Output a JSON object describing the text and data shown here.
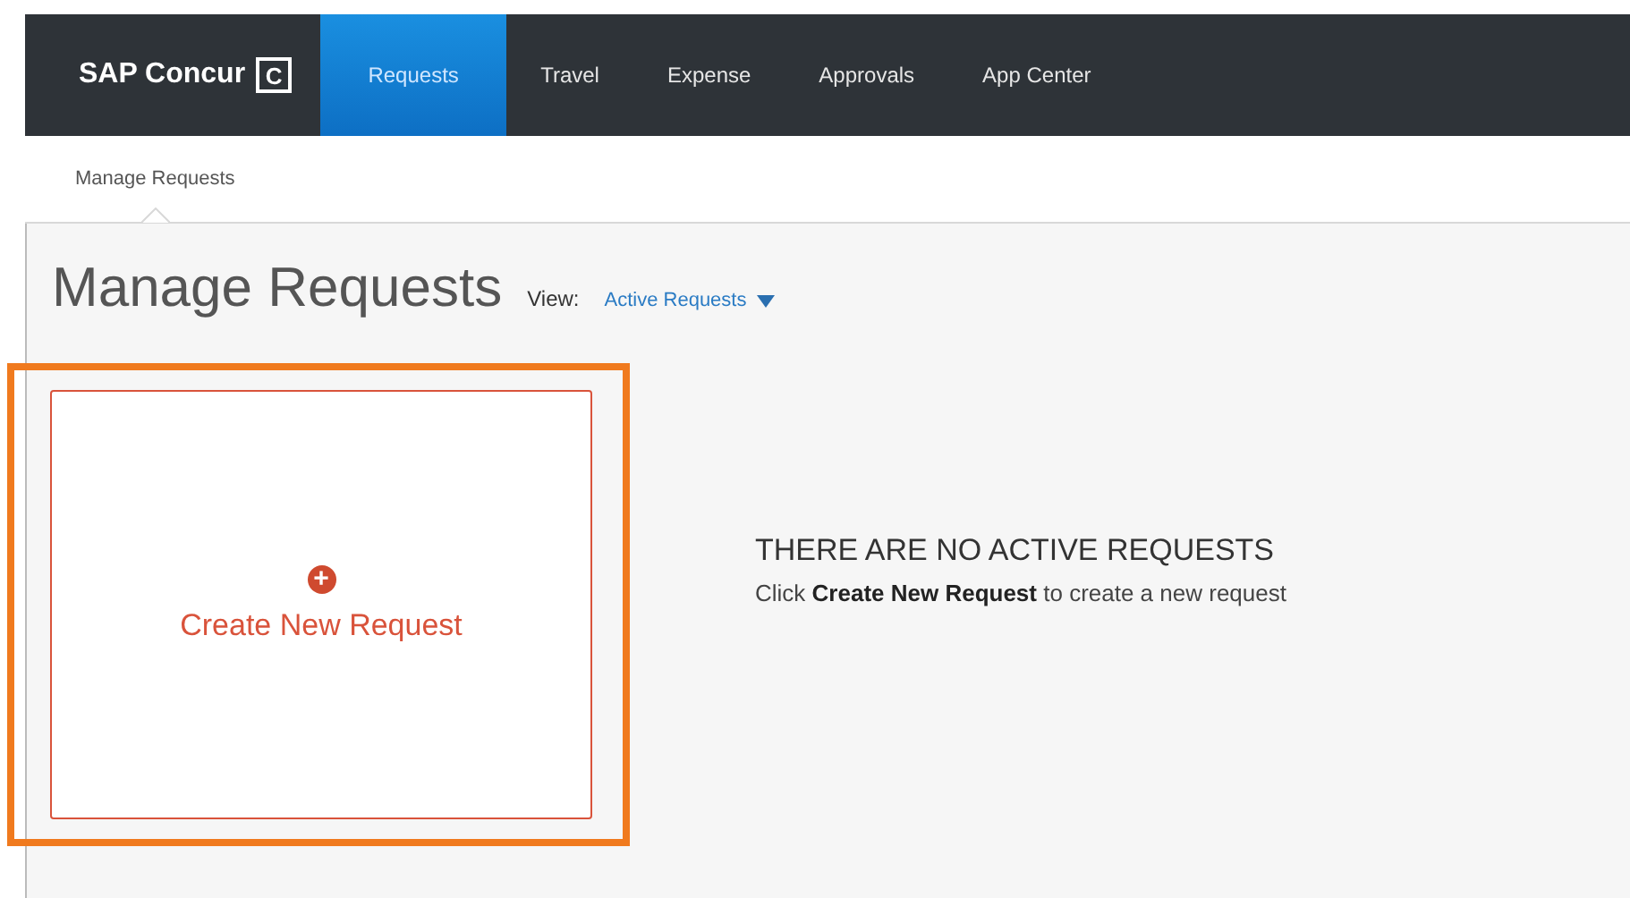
{
  "navbar": {
    "logo": "SAP Concur",
    "logo_mark": "C",
    "tabs": [
      {
        "label": "Requests",
        "selected": true
      },
      {
        "label": "Travel",
        "selected": false
      },
      {
        "label": "Expense",
        "selected": false
      },
      {
        "label": "Approvals",
        "selected": false
      },
      {
        "label": "App Center",
        "selected": false
      }
    ]
  },
  "subnav": {
    "items": [
      {
        "label": "Manage Requests",
        "selected": true
      }
    ]
  },
  "page": {
    "title": "Manage Requests",
    "view_label": "View:",
    "view_value": "Active Requests"
  },
  "create_card": {
    "icon": "+",
    "label": "Create New Request",
    "highlighted": true
  },
  "empty_state": {
    "heading": "THERE ARE NO ACTIVE REQUESTS",
    "message": "Click **Create New Request** to create a new request"
  }
}
